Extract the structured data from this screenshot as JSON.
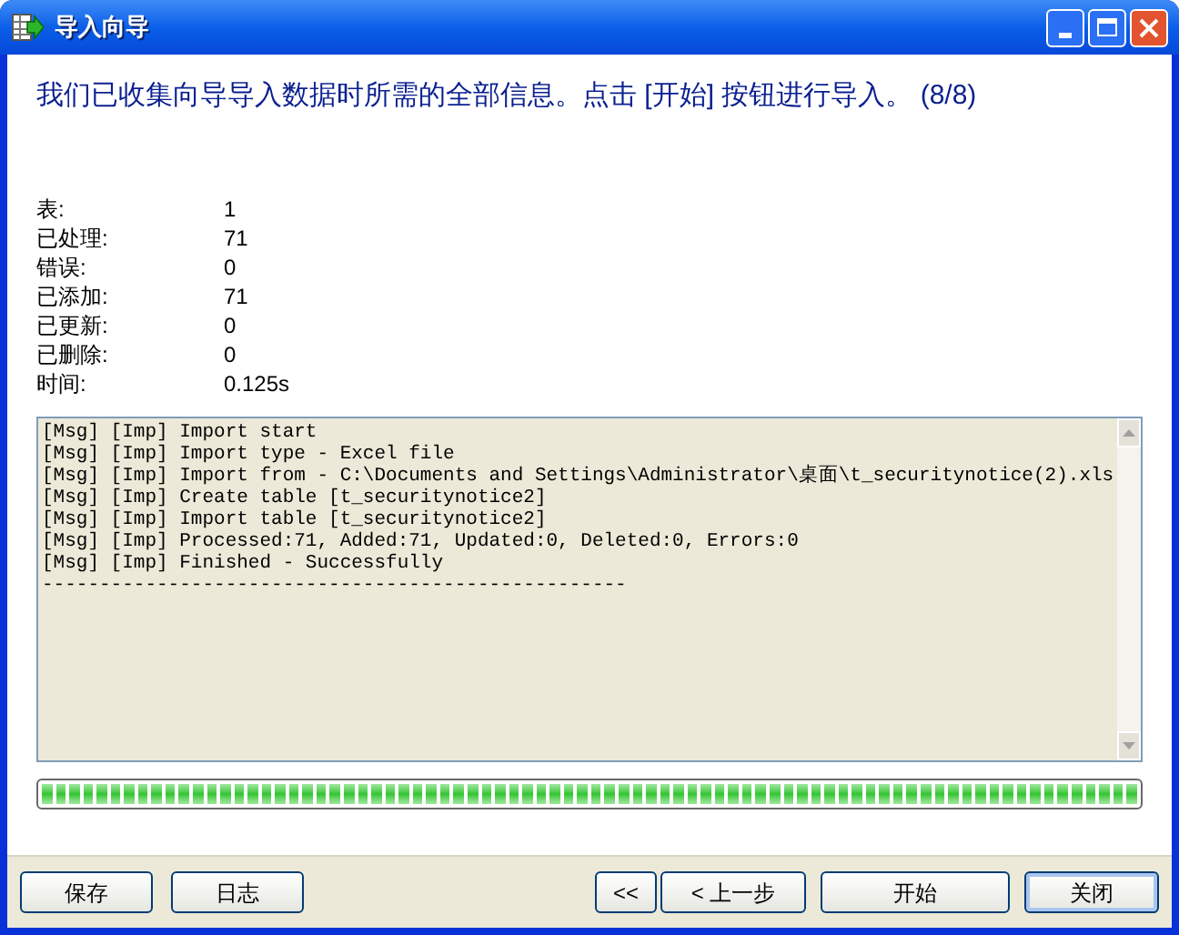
{
  "window": {
    "title": "导入向导"
  },
  "heading": "我们已收集向导导入数据时所需的全部信息。点击 [开始] 按钮进行导入。 (8/8)",
  "stats": [
    {
      "label": "表:",
      "value": "1"
    },
    {
      "label": "已处理:",
      "value": "71"
    },
    {
      "label": "错误:",
      "value": "0"
    },
    {
      "label": "已添加:",
      "value": "71"
    },
    {
      "label": "已更新:",
      "value": "0"
    },
    {
      "label": "已删除:",
      "value": "0"
    },
    {
      "label": "时间:",
      "value": "0.125s"
    }
  ],
  "log": [
    "[Msg] [Imp] Import start",
    "[Msg] [Imp] Import type - Excel file",
    "[Msg] [Imp] Import from - C:\\Documents and Settings\\Administrator\\桌面\\t_securitynotice(2).xls",
    "[Msg] [Imp] Create table [t_securitynotice2]",
    "[Msg] [Imp] Import table [t_securitynotice2]",
    "[Msg] [Imp] Processed:71, Added:71, Updated:0, Deleted:0, Errors:0",
    "[Msg] [Imp] Finished - Successfully",
    "---------------------------------------------------"
  ],
  "progress": {
    "level": 1
  },
  "buttons_left": [
    "保存",
    "日志"
  ],
  "buttons_right": [
    {
      "label": "<<",
      "default": false
    },
    {
      "label": "< 上一步",
      "default": false
    },
    {
      "label": "开始",
      "default": false
    },
    {
      "label": "关闭",
      "default": true
    }
  ]
}
